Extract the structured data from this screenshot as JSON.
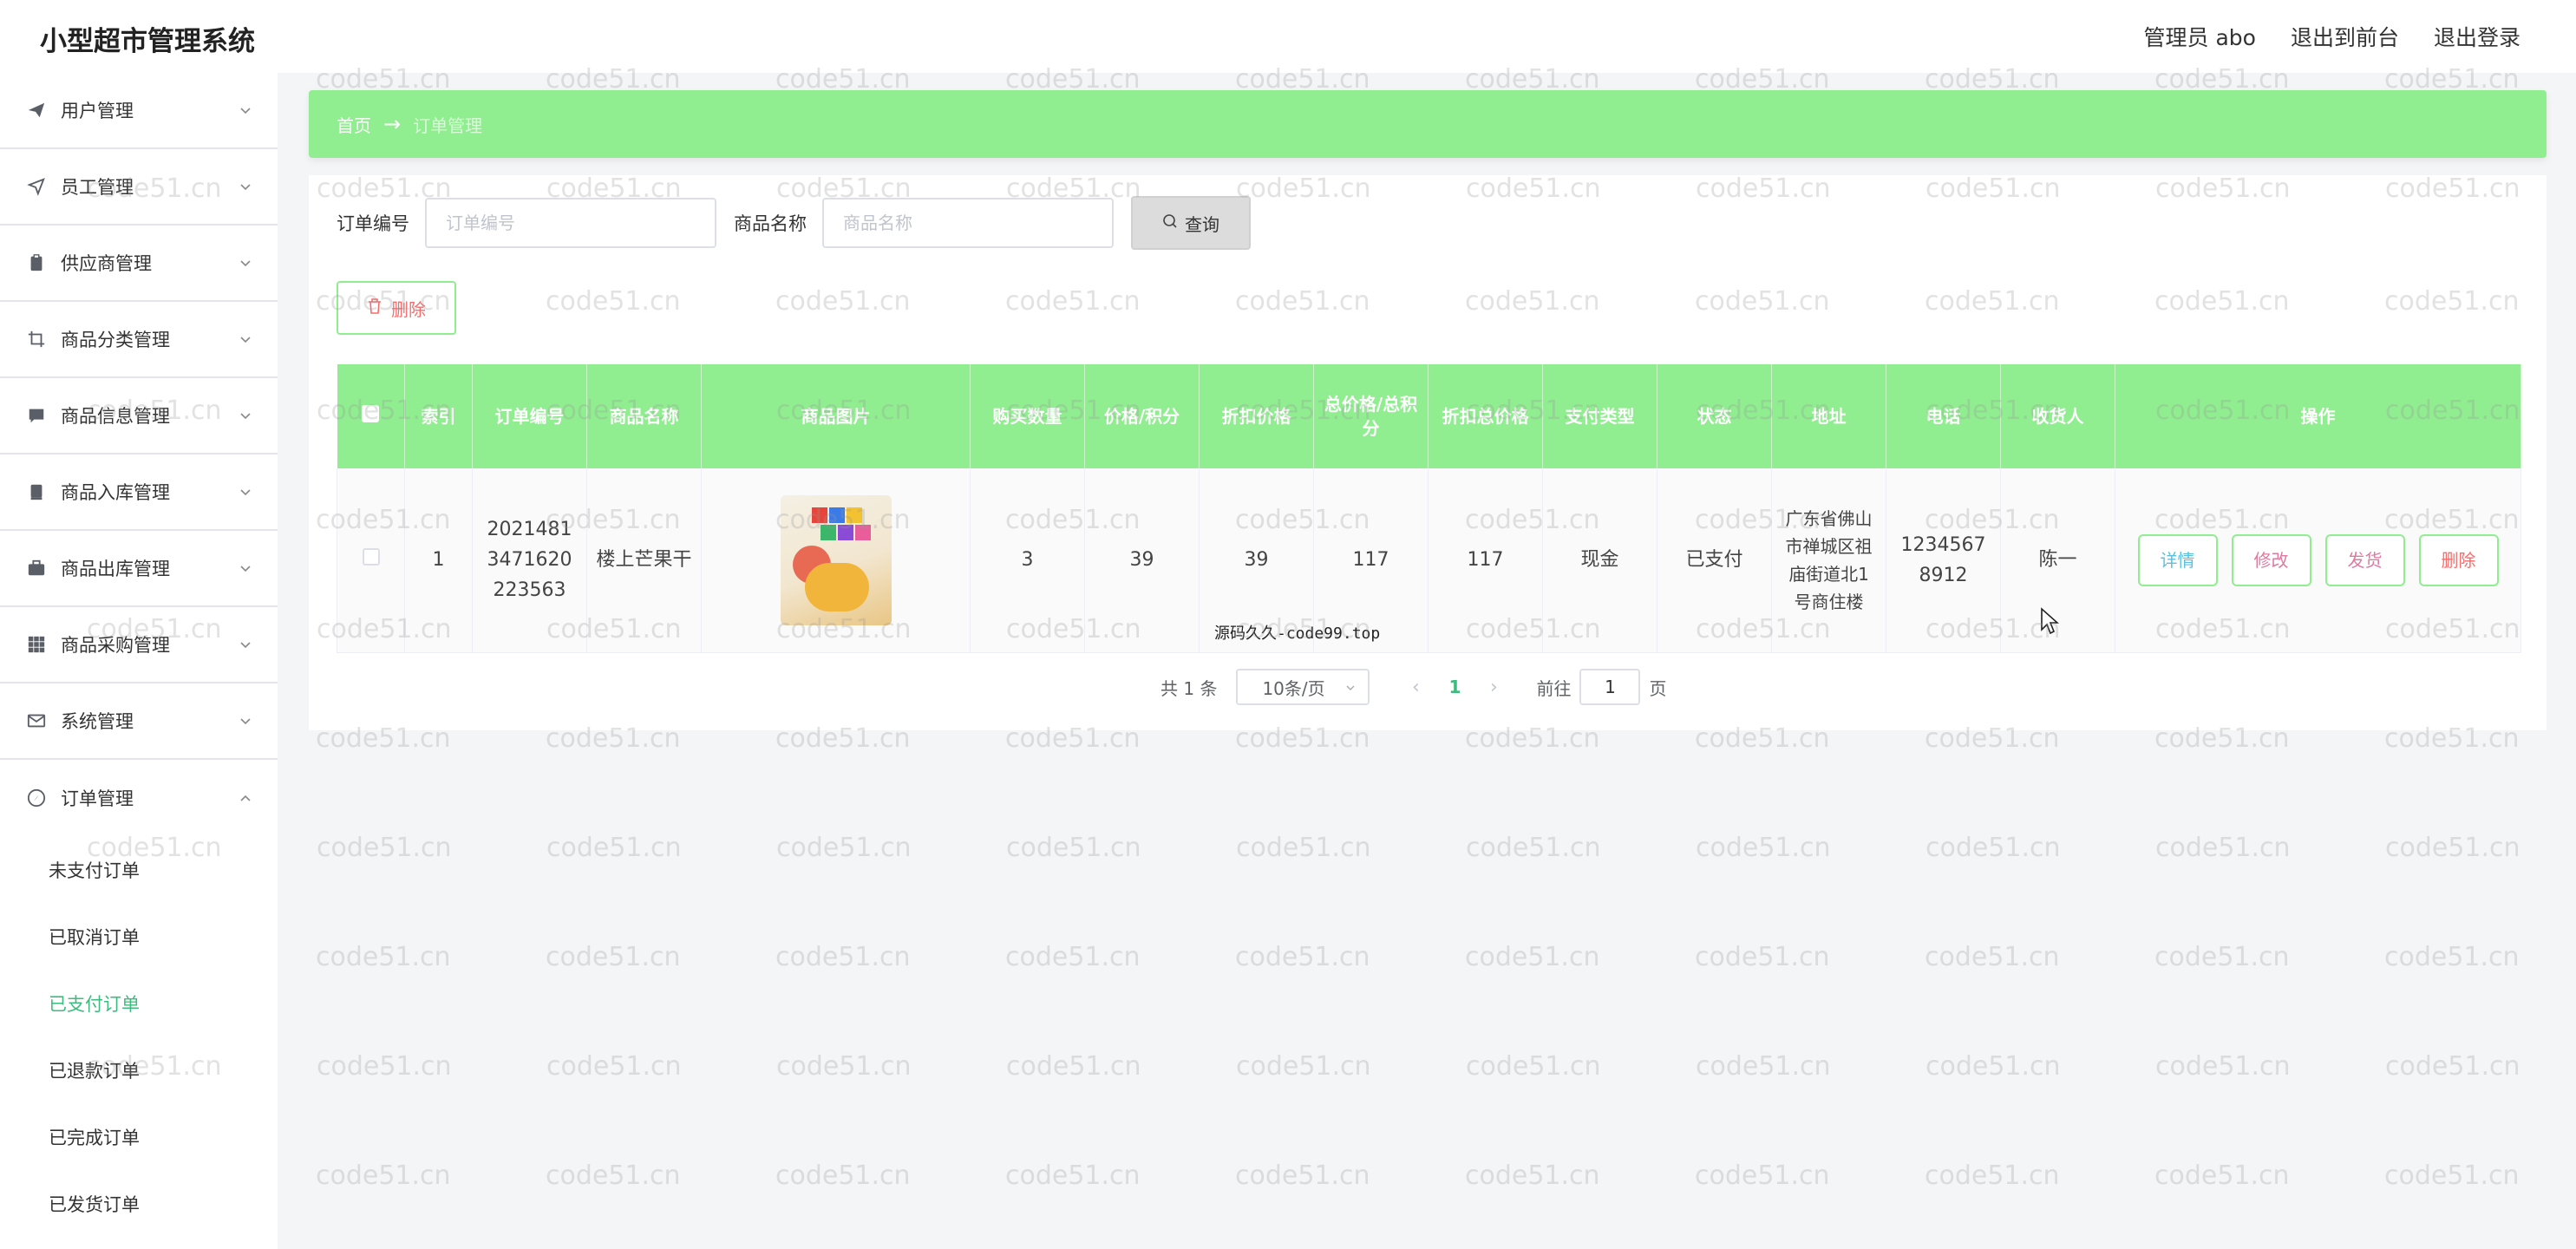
{
  "header": {
    "title": "小型超市管理系统",
    "admin_label": "管理员 abo",
    "to_front_label": "退出到前台",
    "logout_label": "退出登录"
  },
  "sidebar": {
    "items": [
      {
        "label": "用户管理",
        "icon": "send-icon"
      },
      {
        "label": "员工管理",
        "icon": "location-arrow-icon"
      },
      {
        "label": "供应商管理",
        "icon": "clipboard-icon"
      },
      {
        "label": "商品分类管理",
        "icon": "crop-icon"
      },
      {
        "label": "商品信息管理",
        "icon": "chat-icon"
      },
      {
        "label": "商品入库管理",
        "icon": "printer-icon"
      },
      {
        "label": "商品出库管理",
        "icon": "briefcase-icon"
      },
      {
        "label": "商品采购管理",
        "icon": "grid-icon"
      },
      {
        "label": "系统管理",
        "icon": "mail-icon"
      },
      {
        "label": "订单管理",
        "icon": "compass-icon"
      }
    ],
    "order_sub_items": [
      {
        "label": "未支付订单"
      },
      {
        "label": "已取消订单"
      },
      {
        "label": "已支付订单"
      },
      {
        "label": "已退款订单"
      },
      {
        "label": "已完成订单"
      },
      {
        "label": "已发货订单"
      }
    ]
  },
  "breadcrumb": {
    "home": "首页",
    "separator": "→",
    "current": "订单管理"
  },
  "search": {
    "order_no_label": "订单编号",
    "order_no_placeholder": "订单编号",
    "product_name_label": "商品名称",
    "product_name_placeholder": "商品名称",
    "query_label": "查询"
  },
  "toolbar": {
    "delete_label": "删除"
  },
  "table": {
    "columns": [
      "索引",
      "订单编号",
      "商品名称",
      "商品图片",
      "购买数量",
      "价格/积分",
      "折扣价格",
      "总价格/总积分",
      "折扣总价格",
      "支付类型",
      "状态",
      "地址",
      "电话",
      "收货人",
      "操作"
    ],
    "rows": [
      {
        "index": "1",
        "order_no": "20214813471620223563",
        "product_name": "楼上芒果干",
        "quantity": "3",
        "price": "39",
        "discount_price": "39",
        "total": "117",
        "discount_total": "117",
        "pay_type": "现金",
        "status": "已支付",
        "address": "广东省佛山市禅城区祖庙街道北1号商住楼",
        "phone": "12345678912",
        "receiver": "陈一"
      }
    ],
    "actions": {
      "detail": "详情",
      "edit": "修改",
      "ship": "发货",
      "delete": "删除"
    }
  },
  "pagination": {
    "total_text": "共 1 条",
    "page_size": "10条/页",
    "current_page": "1",
    "goto_prefix": "前往",
    "goto_value": "1",
    "goto_suffix": "页"
  },
  "overlay_text": "源码久久-code99.top",
  "watermark": "code51.cn",
  "colors": {
    "accent_green": "#90ee90",
    "active_text": "#3dbd7d",
    "detail_btn": "#5bc0de",
    "edit_btn": "#e07aa0",
    "ship_btn": "#e07aa0",
    "delete_btn": "#f56c6c"
  }
}
